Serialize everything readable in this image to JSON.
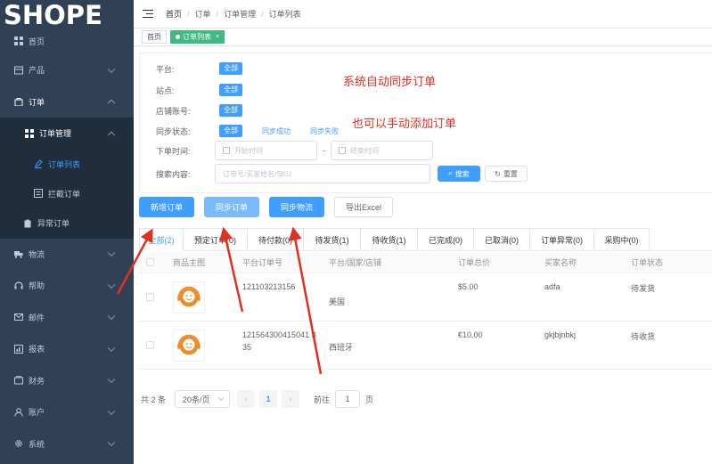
{
  "sidebar": {
    "logo": "SHOPE",
    "items": [
      {
        "label": "首页",
        "icon": "dashboard-icon"
      },
      {
        "label": "产品",
        "icon": "box-icon"
      },
      {
        "label": "订单",
        "icon": "bag-icon"
      },
      {
        "label": "订单管理",
        "icon": "grid-icon"
      },
      {
        "label": "订单列表",
        "icon": "edit-icon"
      },
      {
        "label": "拦截订单",
        "icon": "list-icon"
      },
      {
        "label": "异常订单",
        "icon": "clipboard-icon"
      },
      {
        "label": "物流",
        "icon": "truck-icon"
      },
      {
        "label": "帮助",
        "icon": "headset-icon"
      },
      {
        "label": "邮件",
        "icon": "mail-icon"
      },
      {
        "label": "报表",
        "icon": "chart-icon"
      },
      {
        "label": "财务",
        "icon": "money-icon"
      },
      {
        "label": "账户",
        "icon": "user-icon"
      },
      {
        "label": "系统",
        "icon": "gear-icon"
      }
    ]
  },
  "header": {
    "breadcrumb": [
      "首页",
      "订单",
      "订单管理",
      "订单列表"
    ]
  },
  "tags": {
    "home": "首页",
    "active": "订单列表",
    "close": "×"
  },
  "filter": {
    "platform_label": "平台:",
    "site_label": "站点:",
    "shop_label": "店铺账号:",
    "sync_label": "同步状态:",
    "time_label": "下单时间:",
    "search_label": "搜索内容:",
    "all": "全部",
    "sync_success": "同步成功",
    "sync_fail": "同步失败",
    "start_placeholder": "开始时间",
    "end_placeholder": "结束时间",
    "date_dash": "-",
    "search_placeholder": "订单号/买家姓名/SKU",
    "search_btn": "搜索",
    "reset_btn": "重置"
  },
  "notes": {
    "auto_sync": "系统自动同步订单",
    "manual_add": "也可以手动添加订单"
  },
  "actions": {
    "new_order": "新增订单",
    "sync_order": "同步订单",
    "sync_logistics": "同步物流",
    "export_excel": "导出Excel"
  },
  "tabs": [
    "全部(2)",
    "预定订单(0)",
    "待付款(0)",
    "待发货(1)",
    "待收货(1)",
    "已完成(0)",
    "已取消(0)",
    "订单异常(0)",
    "采购中(0)"
  ],
  "table": {
    "columns": [
      "商品主图",
      "平台订单号",
      "平台/国家/店铺",
      "订单总价",
      "买家名称",
      "订单状态"
    ],
    "rows": [
      {
        "order_no": "121103213156",
        "country": "美国",
        "total": "$5.00",
        "buyer": "adfa",
        "status": "待发货"
      },
      {
        "order_no_line1": "121564300415041 3",
        "order_no_line2": "35",
        "country": "西班牙",
        "total": "€10.00",
        "buyer": "gkjbjnbkj",
        "status": "待收货"
      }
    ]
  },
  "pager": {
    "total": "共 2 条",
    "page_size": "20条/页",
    "prev": "‹",
    "current": "1",
    "next": "›",
    "goto": "前往",
    "goto_value": "1",
    "page_unit": "页"
  },
  "colors": {
    "sidebar_bg": "#304156",
    "primary": "#409eff",
    "tag_active": "#42b983",
    "note_red": "#e0301e"
  }
}
